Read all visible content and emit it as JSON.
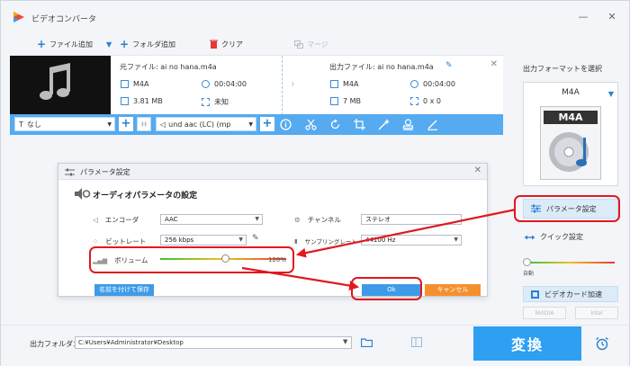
{
  "app": {
    "title": "ビデオコンバータ"
  },
  "toolbar": {
    "add_file": "ファイル追加",
    "add_folder": "フォルダ追加",
    "clear": "クリア",
    "merge": "マージ"
  },
  "file": {
    "source_title": "元ファイル: ai no hana.m4a",
    "output_title": "出力ファイル: ai no hana.m4a",
    "src_format": "M4A",
    "src_duration": "00:04:00",
    "src_size": "3.81 MB",
    "src_resolution": "未知",
    "out_format": "M4A",
    "out_duration": "00:04:00",
    "out_size": "7 MB",
    "out_resolution": "0 x 0"
  },
  "actionbar": {
    "subtitle": "なし",
    "audio_track": "und aac (LC) (mp"
  },
  "rightpanel": {
    "label": "出力フォーマットを選択",
    "format": "M4A",
    "format_badge": "M4A",
    "param_button": "パラメータ設定",
    "quick_button": "クイック設定",
    "quick_auto": "自動",
    "gpu_button": "ビデオカード加速",
    "vendor_nvidia": "NVIDIA",
    "vendor_intel": "Intel"
  },
  "bottom": {
    "output_folder_label": "出力フォルダ：",
    "output_path": "C:¥Users¥Administrator¥Desktop",
    "convert": "変換"
  },
  "dialog": {
    "title": "パラメータ設定",
    "section": "オーディオパラメータの設定",
    "encoder_label": "エンコーダ",
    "encoder_value": "AAC",
    "bitrate_label": "ビットレート",
    "bitrate_value": "256 kbps",
    "channel_label": "チャンネル",
    "channel_value": "ステレオ",
    "samplerate_label": "サンプリングレート",
    "samplerate_value": "44100 Hz",
    "volume_label": "ボリューム",
    "volume_value": "120%",
    "volume_level": 0.52,
    "save_as": "名前を付けて保存",
    "ok": "Ok",
    "cancel": "キャンセル"
  },
  "colors": {
    "accent": "#2f9ff2",
    "actionbar": "#55aaf0",
    "cancel": "#f5902e",
    "annotation": "#e0191f"
  }
}
